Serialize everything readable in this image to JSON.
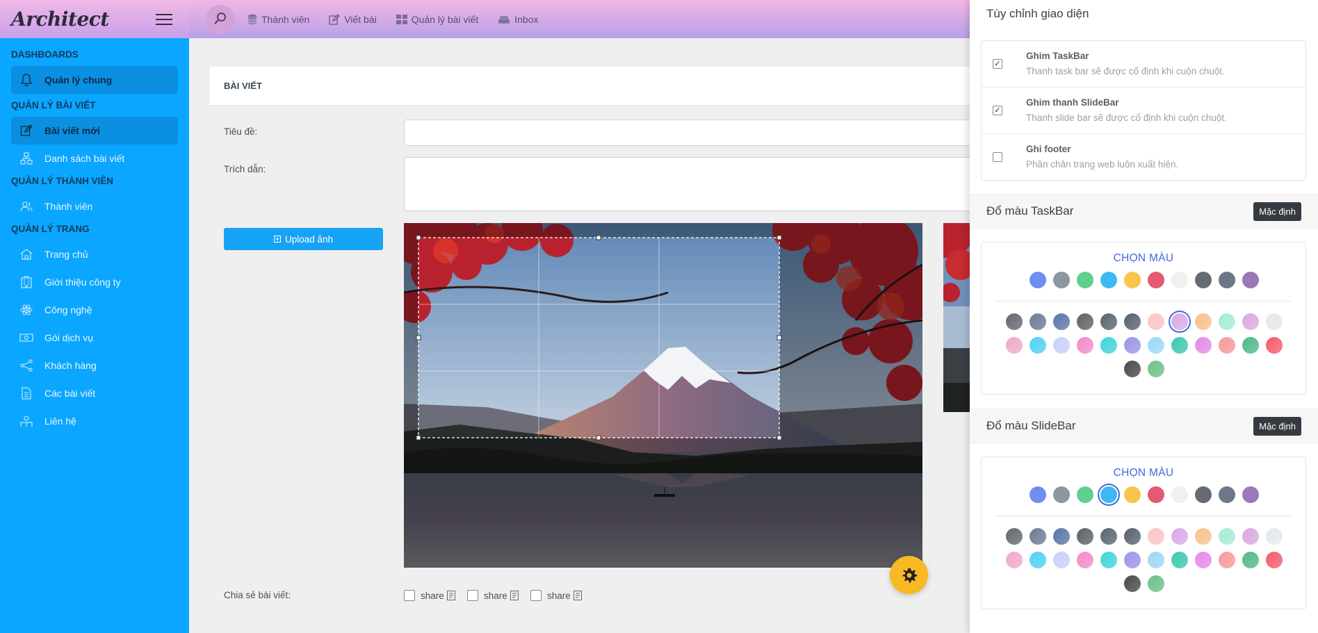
{
  "sidebar": {
    "logo": "Architect",
    "sections": [
      {
        "heading": "DASHBOARDS",
        "items": [
          {
            "label": "Quản lý chung",
            "icon": "bell-icon",
            "active": true
          }
        ]
      },
      {
        "heading": "QUẢN LÝ BÀI VIẾT",
        "items": [
          {
            "label": "Bài viết mới",
            "icon": "edit-icon",
            "active": true
          },
          {
            "label": "Danh sách bài viết",
            "icon": "sitemap-icon"
          }
        ]
      },
      {
        "heading": "QUẢN LÝ THÀNH VIÊN",
        "items": [
          {
            "label": "Thành viên",
            "icon": "users-icon"
          }
        ]
      },
      {
        "heading": "QUẢN LÝ TRANG",
        "items": [
          {
            "label": "Trang chủ",
            "icon": "home-icon"
          },
          {
            "label": "Giới thiệu công ty",
            "icon": "building-icon"
          },
          {
            "label": "Công nghệ",
            "icon": "atom-icon"
          },
          {
            "label": "Gói dịch vụ",
            "icon": "money-icon"
          },
          {
            "label": "Khách hàng",
            "icon": "share-icon"
          },
          {
            "label": "Các bài viết",
            "icon": "document-icon"
          },
          {
            "label": "Liên hệ",
            "icon": "contact-icon"
          }
        ]
      }
    ]
  },
  "topbar": {
    "links": [
      {
        "label": "Thành viên",
        "icon": "database-icon"
      },
      {
        "label": "Viết bài",
        "icon": "edit-icon"
      },
      {
        "label": "Quản lý bài viết",
        "icon": "grid-icon"
      },
      {
        "label": "Inbox",
        "icon": "inbox-icon"
      }
    ]
  },
  "form": {
    "header": "BÀI VIẾT",
    "title_label": "Tiêu đề:",
    "title_value": "",
    "excerpt_label": "Trích dẫn:",
    "excerpt_value": "",
    "upload_label": "Upload ảnh",
    "share_label": "Chia sẻ bài viết:",
    "share_options": [
      "share",
      "share",
      "share"
    ]
  },
  "panel": {
    "title": "Tùy chỉnh giao diện",
    "options": [
      {
        "title": "Ghim TaskBar",
        "desc": "Thanh task bar sẽ được cố định khi cuộn chuột.",
        "checked": true
      },
      {
        "title": "Ghim thanh SlideBar",
        "desc": "Thanh slide bar sẽ được cố định khi cuộn chuột.",
        "checked": true
      },
      {
        "title": "Ghi footer",
        "desc": "Phần chân trang web luôn xuất hiện.",
        "checked": false
      }
    ],
    "taskbar": {
      "heading": "Đổ màu TaskBar",
      "default_label": "Mặc định",
      "pick_label": "CHỌN MÀU"
    },
    "slidebar": {
      "heading": "Đổ màu SlideBar",
      "default_label": "Mặc định",
      "pick_label": "CHỌN MÀU"
    }
  },
  "colors": {
    "solid": [
      "#6f8ff0",
      "#8e969e",
      "#5fd08e",
      "#3fb8f5",
      "#f7c44c",
      "#e35a72",
      "#f0f0f0",
      "#646b72",
      "#70768a",
      "#9a79b8"
    ],
    "gradients_row1": [
      "#63676e",
      "#6d7a94",
      "#5a74a8",
      "#5c6166",
      "#55666e",
      "#576070",
      "#fbc4c4",
      "#d9a9e6",
      "#f8c08a",
      "#a4ecd6",
      "#d9a9df",
      "#e3e8ec"
    ],
    "gradients_row2": [
      "#f0a8c8",
      "#4fd0f5",
      "#c8d0f8",
      "#f58ac8",
      "#3ed4d8",
      "#9a94e8",
      "#9ad8f8",
      "#3cc8b0",
      "#e48ae8",
      "#f89898",
      "#50b888",
      "#f55a6a"
    ],
    "gradients_row3": [
      "#484848",
      "#6cc088"
    ],
    "taskbar_selected": "gradients_row1.7",
    "slidebar_selected": "solid.3"
  }
}
